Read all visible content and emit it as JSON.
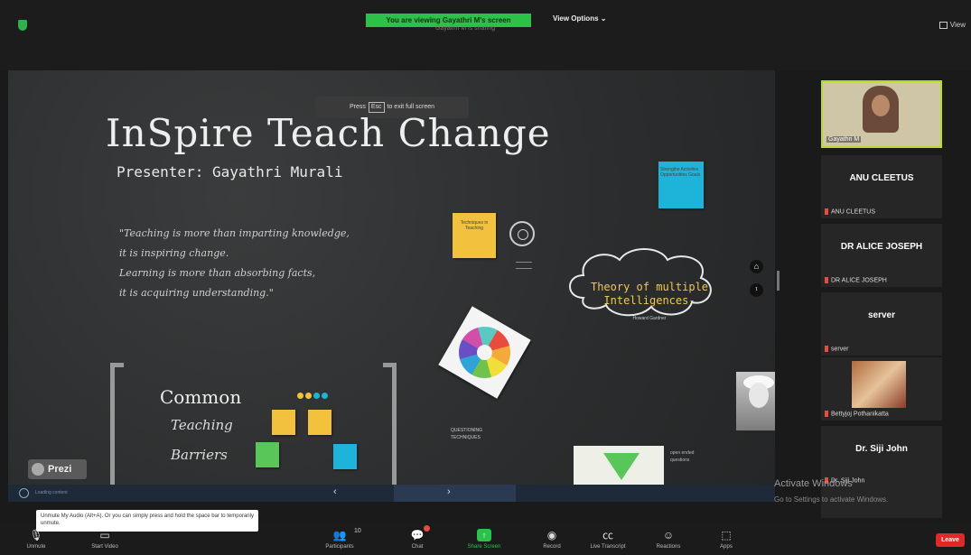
{
  "top": {
    "viewing_banner": "You are viewing Gayathri M's screen",
    "viewing_sub": "Gayathri M is sharing",
    "view_options": "View Options ⌄",
    "view_button": "View"
  },
  "slide": {
    "exit_prefix": "Press",
    "exit_key": "Esc",
    "exit_suffix": "to exit full screen",
    "title": "InSpire Teach Change",
    "presenter": "Presenter: Gayathri Murali",
    "quote_lines": [
      "\"Teaching is more than imparting knowledge,",
      "it is inspiring change.",
      "Learning is more than absorbing facts,",
      "it is acquiring understanding.\""
    ],
    "sticky_techniques": "Techniques in Teaching",
    "sticky_blue_top": "Strengths Activities Opportunities Goals",
    "cloud_title_1": "Theory of multiple",
    "cloud_title_2": "Intelligences-",
    "cloud_sub": "Howard Gardner",
    "common": "Common",
    "teaching": "Teaching",
    "barriers": "Barriers",
    "questioning_1": "QUESTIONING",
    "questioning_2": "TECHNIQUES",
    "funnel_text_1": "open ended",
    "funnel_text_2": "questions",
    "prezi": "Prezi",
    "home_icon_glyph": "⌂",
    "up_icon_glyph": "ᵗ",
    "presbar_text": "Loading content",
    "prev_glyph": "‹",
    "next_glyph": "›"
  },
  "participants": [
    {
      "name": "Gayathri M",
      "label": "Gayathri M",
      "active": true
    },
    {
      "name": "ANU CLEETUS",
      "label": "ANU CLEETUS"
    },
    {
      "name": "DR ALICE JOSEPH",
      "label": "DR ALICE JOSEPH"
    },
    {
      "name": "server",
      "label": "server"
    },
    {
      "name": "Bettyjoj Pothanikatta",
      "label": "Bettyjoj Pothanikatta"
    },
    {
      "name": "Dr. Siji John",
      "label": "Dr. Siji John"
    }
  ],
  "watermark": {
    "line1": "Activate Windows",
    "line2": "Go to Settings to activate Windows."
  },
  "tooltip": "Unmute My Audio (Alt+A). Or you can simply press and hold the space bar to temporarily unmute.",
  "toolbar": {
    "unmute": "Unmute",
    "start_video": "Start Video",
    "participants": "Participants",
    "participants_count": "10",
    "chat": "Chat",
    "share": "Share Screen",
    "record": "Record",
    "transcript": "Live Transcript",
    "reactions": "Reactions",
    "apps": "Apps",
    "leave": "Leave"
  },
  "colors": {
    "zoom_green": "#2cc24a",
    "leave_red": "#e02a2a",
    "active_speaker": "#b6dc2b",
    "cloud_text": "#f0c94e"
  }
}
